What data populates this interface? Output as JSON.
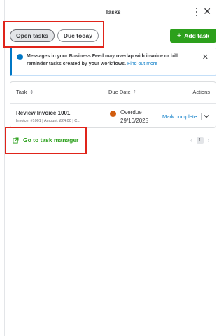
{
  "header": {
    "title": "Tasks"
  },
  "filters": {
    "open_tasks": "Open tasks",
    "due_today": "Due today"
  },
  "toolbar": {
    "add_task_label": "Add task",
    "add_task_plus": "+"
  },
  "banner": {
    "message": "Messages in your Business Feed may overlap with invoice or bill reminder tasks created by your workflows. ",
    "link": "Find out more"
  },
  "table": {
    "headers": {
      "task": "Task",
      "due_date": "Due Date",
      "actions": "Actions"
    },
    "rows": [
      {
        "title": "Review Invoice 1001",
        "subtitle": "Invoice: #1001 | Amount: £24.00 | C...",
        "status": "Overdue",
        "due_date": "29/10/2025",
        "action": "Mark complete"
      }
    ]
  },
  "footer": {
    "goto_label": "Go to task manager"
  },
  "pagination": {
    "current_page": "1"
  },
  "colors": {
    "brand_green": "#2ca01c",
    "link_blue": "#0077c5",
    "overdue_orange": "#d15c0e",
    "highlight_red": "#e0241a"
  },
  "icons": [
    "kebab-menu-icon",
    "close-icon",
    "info-icon",
    "overdue-warning-icon",
    "chevron-down-icon",
    "external-link-icon",
    "chevron-left-icon",
    "chevron-right-icon",
    "sort-icon",
    "sort-up-icon"
  ]
}
